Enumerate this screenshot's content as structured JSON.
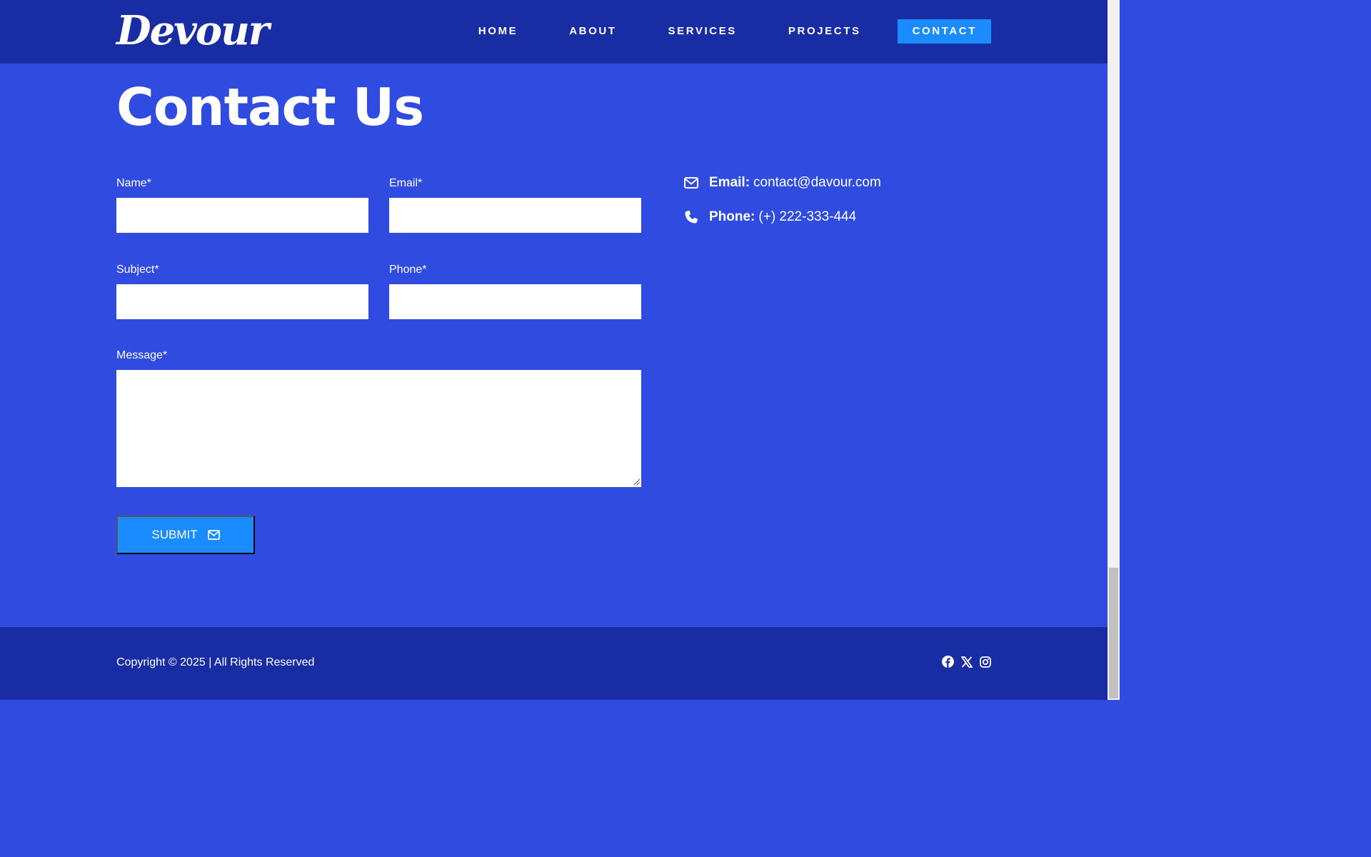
{
  "header": {
    "logo": "Devour",
    "nav": [
      "HOME",
      "ABOUT",
      "SERVICES",
      "PROJECTS"
    ],
    "nav_active": "CONTACT"
  },
  "page": {
    "title": "Contact Us"
  },
  "form": {
    "name_label": "Name*",
    "email_label": "Email*",
    "subject_label": "Subject*",
    "phone_label": "Phone*",
    "message_label": "Message*",
    "submit_label": "SUBMIT"
  },
  "contact_info": {
    "email_label": "Email:",
    "email_value": "contact@davour.com",
    "phone_label": "Phone:",
    "phone_value": "(+) 222-333-444"
  },
  "footer": {
    "copyright": "Copyright © 2025 | All Rights Reserved",
    "social_icons": [
      "facebook-icon",
      "x-icon",
      "instagram-icon"
    ]
  },
  "colors": {
    "background": "#2f4be0",
    "header_footer": "#182ca3",
    "accent": "#1a8cff"
  }
}
